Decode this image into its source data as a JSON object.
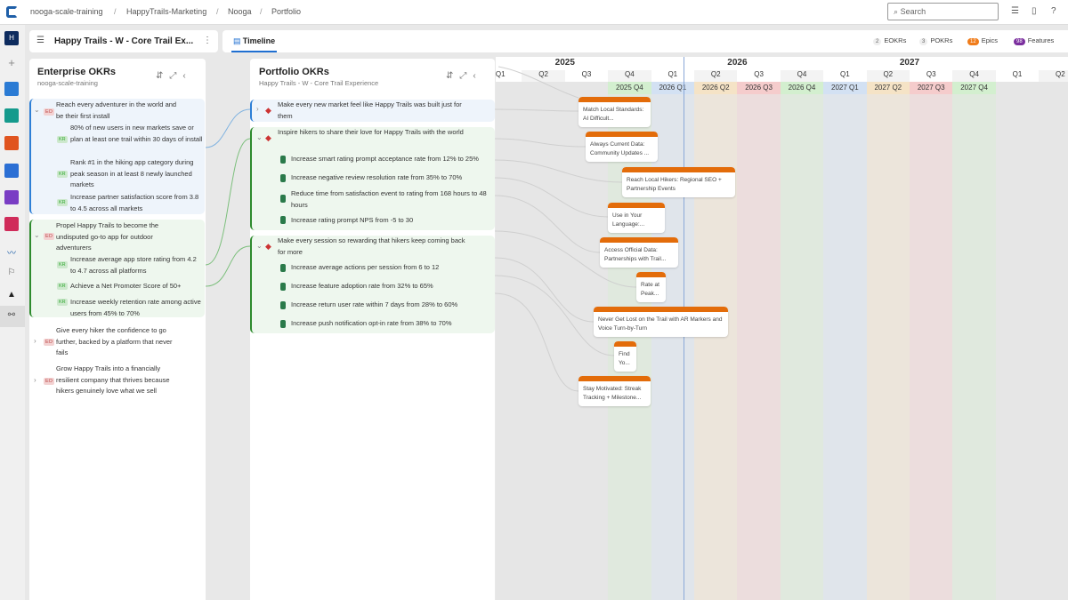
{
  "breadcrumb": [
    "nooga-scale-training",
    "HappyTrails-Marketing",
    "Nooga",
    "Portfolio"
  ],
  "search": {
    "placeholder": "Search"
  },
  "rail": {
    "avatar": "H"
  },
  "portfolio_selector": {
    "title": "Happy Trails - W - Core Trail Ex..."
  },
  "tabs": {
    "timeline": "Timeline"
  },
  "counts": {
    "eokrs": {
      "n": "2",
      "label": "EOKRs"
    },
    "pokrs": {
      "n": "3",
      "label": "POKRs"
    },
    "epics": {
      "n": "12",
      "label": "Epics",
      "color": "#f07c1a"
    },
    "features": {
      "n": "98",
      "label": "Features",
      "color": "#7b2f9e"
    }
  },
  "enterprise": {
    "title": "Enterprise OKRs",
    "subtitle": "nooga-scale-training",
    "eo_tag": "EO",
    "kr_tag": "KR",
    "objectives": [
      {
        "text": "Reach every adventurer in the world and be their first install",
        "krs": [
          "80% of new users in new markets save or plan at least one trail within 30 days of install",
          "Rank #1 in the hiking app category during peak season in at least 8 newly launched markets",
          "Increase partner satisfaction score from 3.8 to 4.5 across all markets"
        ]
      },
      {
        "text": "Propel Happy Trails to become the undisputed go-to app for outdoor adventurers",
        "krs": [
          "Increase average app store rating from 4.2 to 4.7 across all platforms",
          "Achieve a Net Promoter Score of 50+",
          "Increase weekly retention rate among active users from 45% to 70%"
        ]
      },
      {
        "text": "Give every hiker the confidence to go further, backed by a platform that never fails"
      },
      {
        "text": "Grow Happy Trails into a financially resilient company that thrives because hikers genuinely love what we sell"
      }
    ]
  },
  "portfolio": {
    "title": "Portfolio OKRs",
    "subtitle": "Happy Trails - W - Core Trail Experience",
    "objectives": [
      {
        "text": "Make every new market feel like Happy Trails was built just for them"
      },
      {
        "text": "Inspire hikers to share their love for Happy Trails with the world",
        "krs": [
          "Increase smart rating prompt acceptance rate from 12% to 25%",
          "Increase negative review resolution rate from 35% to 70%",
          "Reduce time from satisfaction event to rating from 168 hours to 48 hours",
          "Increase rating prompt NPS from -5 to 30"
        ]
      },
      {
        "text": "Make every session so rewarding that hikers keep coming back for more",
        "krs": [
          "Increase average actions per session from 6 to 12",
          "Increase feature adoption rate from 32% to 65%",
          "Increase return user rate within 7 days from 28% to 60%",
          "Increase push notification opt-in rate from 38% to 70%"
        ]
      }
    ]
  },
  "timeline": {
    "years": [
      "2025",
      "2026",
      "2027"
    ],
    "quarters": [
      "Q1",
      "Q2",
      "Q3",
      "Q4",
      "Q1",
      "Q2",
      "Q3",
      "Q4",
      "Q1",
      "Q2",
      "Q3",
      "Q4",
      "Q1",
      "Q2"
    ],
    "pi_labels": [
      {
        "label": "2025 Q4",
        "color": "#d3efcf"
      },
      {
        "label": "2026 Q1",
        "color": "#d3e1f3"
      },
      {
        "label": "2026 Q2",
        "color": "#f5e3c6"
      },
      {
        "label": "2026 Q3",
        "color": "#f5cccc"
      },
      {
        "label": "2026 Q4",
        "color": "#d3efcf"
      },
      {
        "label": "2027 Q1",
        "color": "#d3e1f3"
      },
      {
        "label": "2027 Q2",
        "color": "#f5e3c6"
      },
      {
        "label": "2027 Q3",
        "color": "#f5cccc"
      },
      {
        "label": "2027 Q4",
        "color": "#d3efcf"
      }
    ],
    "epics": [
      "Match Local Standards: AI Difficult...",
      "Always Current Data: Community Updates ...",
      "Reach Local Hikers: Regional SEO + Partnership Events",
      "Use in Your Language:...",
      "Access Official Data: Partnerships with Trail...",
      "Rate at Peak...",
      "Never Get Lost on the Trail with AR Markers and Voice Turn-by-Turn",
      "Find Yo...",
      "Stay Motivated: Streak Tracking + Milestone..."
    ]
  }
}
